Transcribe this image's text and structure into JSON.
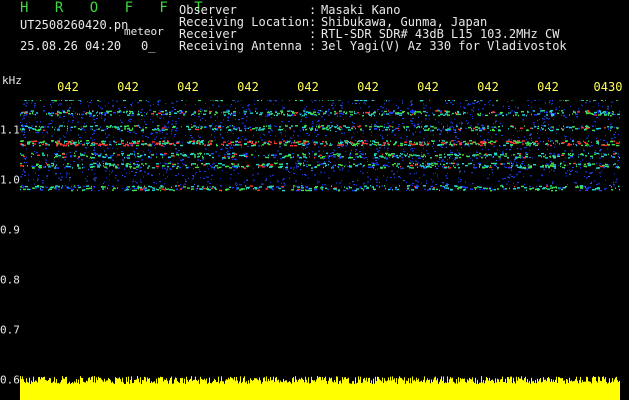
{
  "header": {
    "station_title": "H R O F F T",
    "file_name": "UT2508260420.pn",
    "mode": "meteor",
    "datetime": "25.08.26 04:20",
    "count": "0_",
    "info": [
      {
        "label": "Observer",
        "sep": ":",
        "value": "Masaki Kano"
      },
      {
        "label": "Receiving Location",
        "sep": ":",
        "value": "Shibukawa, Gunma, Japan"
      },
      {
        "label": "Receiver",
        "sep": ":",
        "value": "RTL-SDR SDR# 43dB L15 103.2MHz CW"
      },
      {
        "label": "Receiving Antenna",
        "sep": ":",
        "value": "3el Yagi(V) Az 330 for Vladivostok"
      }
    ]
  },
  "axes": {
    "unit": "kHz",
    "time_ticks": [
      "042",
      "042",
      "042",
      "042",
      "042",
      "042",
      "042",
      "042",
      "042",
      "0430"
    ],
    "freq_ticks": [
      "1.1",
      "1.0",
      "0.9",
      "0.8",
      "0.7",
      "0.6"
    ]
  },
  "colors": {
    "background": "#000000",
    "title_green": "#3fd63f",
    "tick_yellow": "#ffff55",
    "text": "#e8e8e8",
    "level_yellow": "#ffff00",
    "noise_blue": "#1a3cff",
    "band_cyan": "#22d6c8",
    "band_green": "#3fe04a",
    "band_red": "#ff3030"
  },
  "spectrogram": {
    "bands": [
      {
        "freq": 1.04,
        "strength": 0.55
      },
      {
        "freq": 1.005,
        "strength": 0.55
      },
      {
        "freq": 0.99,
        "strength": 0.75
      },
      {
        "freq": 0.965,
        "strength": 0.5
      },
      {
        "freq": 0.935,
        "strength": 0.7
      },
      {
        "freq": 0.905,
        "strength": 0.6
      },
      {
        "freq": 0.875,
        "strength": 1.0
      },
      {
        "freq": 0.85,
        "strength": 0.55
      },
      {
        "freq": 0.83,
        "strength": 0.7
      },
      {
        "freq": 0.785,
        "strength": 0.55
      }
    ]
  }
}
